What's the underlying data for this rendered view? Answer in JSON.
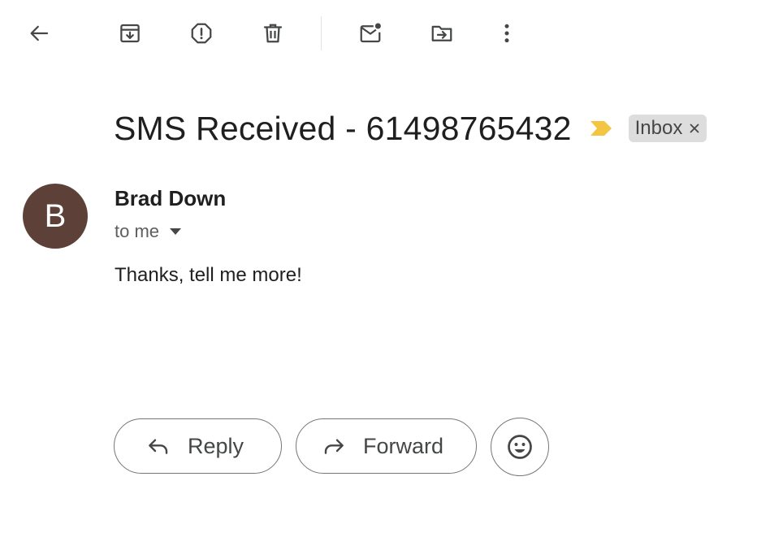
{
  "toolbar": {
    "icons": [
      "back-arrow-icon",
      "archive-icon",
      "report-spam-icon",
      "delete-icon",
      "mark-unread-icon",
      "move-to-icon",
      "more-vert-icon"
    ]
  },
  "message": {
    "subject": "SMS Received - 61498765432",
    "label": "Inbox",
    "sender": {
      "initial": "B",
      "name": "Brad Down",
      "recipients": "to me"
    },
    "body": "Thanks, tell me more!"
  },
  "actions": {
    "reply_label": "Reply",
    "forward_label": "Forward"
  },
  "colors": {
    "avatar_bg": "#5d4037",
    "importance_marker": "#f4c542",
    "chip_bg": "#dddddd",
    "icon": "#444746"
  }
}
